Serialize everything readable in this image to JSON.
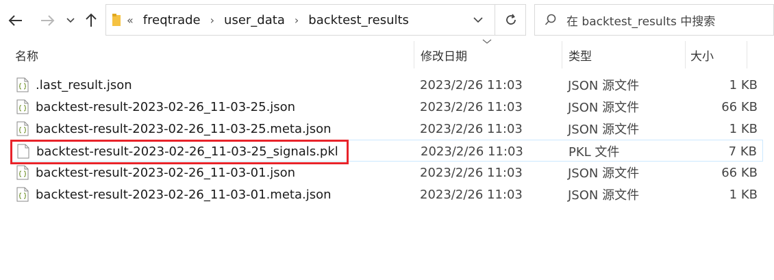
{
  "nav": {
    "back_icon": "arrow-left-icon",
    "forward_icon": "arrow-right-icon",
    "recent_icon": "chevron-down-icon",
    "up_icon": "arrow-up-icon"
  },
  "address": {
    "lead": "«",
    "crumbs": [
      "freqtrade",
      "user_data",
      "backtest_results"
    ],
    "sep": "›"
  },
  "search": {
    "placeholder": "在 backtest_results 中搜索"
  },
  "columns": {
    "name": "名称",
    "date": "修改日期",
    "type": "类型",
    "size": "大小"
  },
  "files": [
    {
      "name": ".last_result.json",
      "date": "2023/2/26 11:03",
      "type": "JSON 源文件",
      "size": "1 KB",
      "icon": "json-file-icon"
    },
    {
      "name": "backtest-result-2023-02-26_11-03-25.json",
      "date": "2023/2/26 11:03",
      "type": "JSON 源文件",
      "size": "66 KB",
      "icon": "json-file-icon"
    },
    {
      "name": "backtest-result-2023-02-26_11-03-25.meta.json",
      "date": "2023/2/26 11:03",
      "type": "JSON 源文件",
      "size": "1 KB",
      "icon": "json-file-icon"
    },
    {
      "name": "backtest-result-2023-02-26_11-03-25_signals.pkl",
      "date": "2023/2/26 11:03",
      "type": "PKL 文件",
      "size": "7 KB",
      "icon": "generic-file-icon"
    },
    {
      "name": "backtest-result-2023-02-26_11-03-01.json",
      "date": "2023/2/26 11:03",
      "type": "JSON 源文件",
      "size": "66 KB",
      "icon": "json-file-icon"
    },
    {
      "name": "backtest-result-2023-02-26_11-03-01.meta.json",
      "date": "2023/2/26 11:03",
      "type": "JSON 源文件",
      "size": "1 KB",
      "icon": "json-file-icon"
    }
  ],
  "colors": {
    "highlight_border": "#cce8ff",
    "annotation": "#e8232a",
    "folder": "#f5c242"
  }
}
